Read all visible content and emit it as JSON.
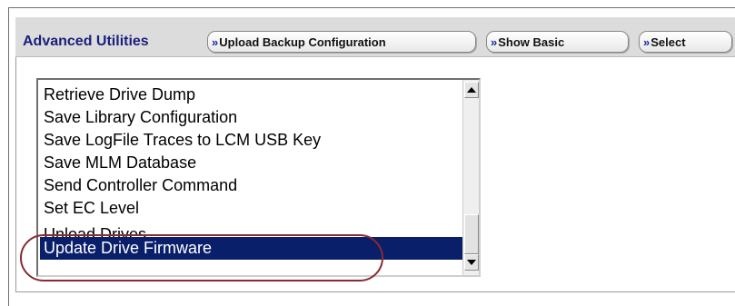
{
  "header": {
    "title": "Advanced Utilities",
    "buttons": [
      {
        "chevron": "»",
        "label": "Upload Backup Configuration"
      },
      {
        "chevron": "»",
        "label": "Show Basic"
      },
      {
        "chevron": "»",
        "label": "Select"
      }
    ]
  },
  "utilities_list": {
    "items": [
      "Retrieve Drive Dump",
      "Save Library Configuration",
      "Save LogFile Traces to LCM USB Key",
      "Save MLM Database",
      "Send Controller Command",
      "Set EC Level",
      "Unload Drives",
      "Update Drive Firmware"
    ],
    "selected": "Update Drive Firmware",
    "scrollbar": {
      "up_icon": "triangle-up",
      "down_icon": "triangle-down"
    }
  },
  "colors": {
    "title": "#1a1f7c",
    "selection_bg": "#0a1f6a",
    "callout": "#8b2a33",
    "header_bg": "#dcdcdc"
  }
}
